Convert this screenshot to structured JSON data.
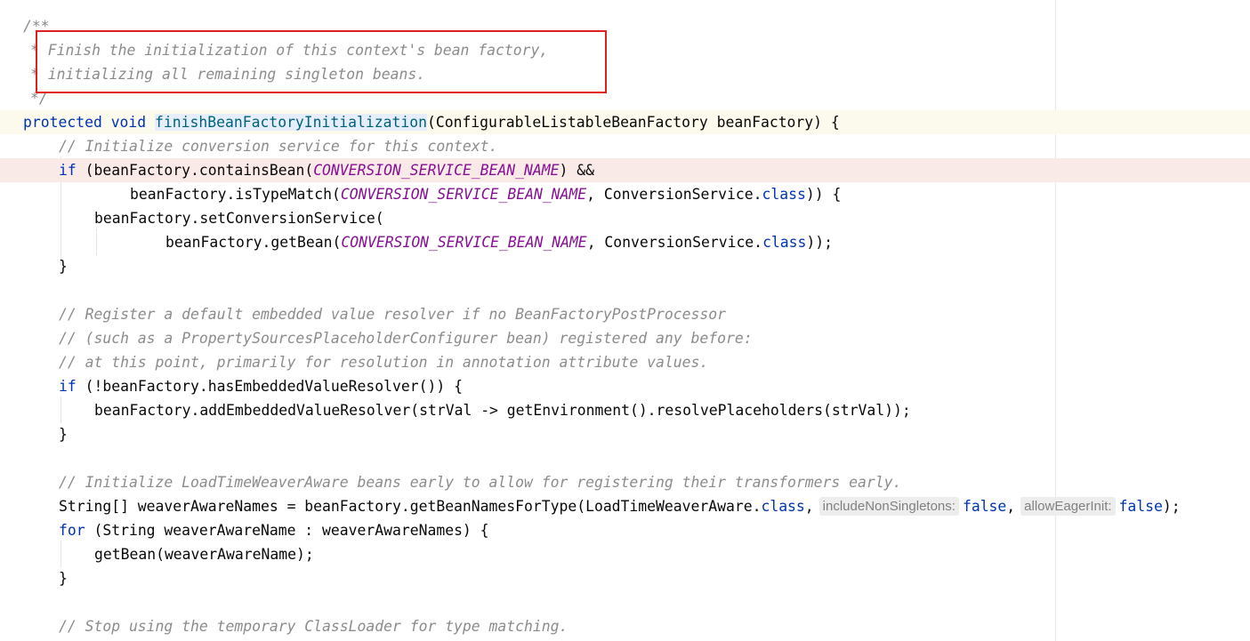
{
  "editor": {
    "lines": [
      {
        "indent": 26,
        "row": 0,
        "tokens": [
          {
            "t": "comment",
            "v": "/**"
          }
        ]
      },
      {
        "indent": 34,
        "row": 1,
        "tokens": [
          {
            "t": "comment",
            "v": "* Finish the initialization of this context's bean factory,"
          }
        ]
      },
      {
        "indent": 34,
        "row": 2,
        "tokens": [
          {
            "t": "comment",
            "v": "* initializing all remaining singleton beans."
          }
        ]
      },
      {
        "indent": 34,
        "row": 3,
        "tokens": [
          {
            "t": "comment",
            "v": "*/"
          }
        ]
      },
      {
        "indent": 26,
        "row": 4,
        "style": "caret-row",
        "tokens": [
          {
            "t": "kw",
            "v": "protected"
          },
          {
            "t": "plain",
            "v": " "
          },
          {
            "t": "kw",
            "v": "void"
          },
          {
            "t": "plain",
            "v": " "
          },
          {
            "t": "caret",
            "v": ""
          },
          {
            "t": "decl",
            "v": "finishBeanFactoryInitialization"
          },
          {
            "t": "plain",
            "v": "(ConfigurableListableBeanFactory beanFactory) {"
          }
        ]
      },
      {
        "indent": 66,
        "row": 5,
        "tokens": [
          {
            "t": "comment",
            "v": "// Initialize conversion service for this context."
          }
        ]
      },
      {
        "indent": 66,
        "row": 6,
        "style": "bp-row",
        "tokens": [
          {
            "t": "kw",
            "v": "if"
          },
          {
            "t": "plain",
            "v": " (beanFactory.containsBean("
          },
          {
            "t": "const",
            "v": "CONVERSION_SERVICE_BEAN_NAME"
          },
          {
            "t": "plain",
            "v": ") &&"
          }
        ]
      },
      {
        "indent": 146,
        "row": 7,
        "tokens": [
          {
            "t": "plain",
            "v": "beanFactory.isTypeMatch("
          },
          {
            "t": "const",
            "v": "CONVERSION_SERVICE_BEAN_NAME"
          },
          {
            "t": "plain",
            "v": ", ConversionService."
          },
          {
            "t": "kw",
            "v": "class"
          },
          {
            "t": "plain",
            "v": ")) {"
          }
        ]
      },
      {
        "indent": 106,
        "row": 8,
        "tokens": [
          {
            "t": "plain",
            "v": "beanFactory.setConversionService("
          }
        ]
      },
      {
        "indent": 186,
        "row": 9,
        "tokens": [
          {
            "t": "plain",
            "v": "beanFactory.getBean("
          },
          {
            "t": "const",
            "v": "CONVERSION_SERVICE_BEAN_NAME"
          },
          {
            "t": "plain",
            "v": ", ConversionService."
          },
          {
            "t": "kw",
            "v": "class"
          },
          {
            "t": "plain",
            "v": "));"
          }
        ]
      },
      {
        "indent": 66,
        "row": 10,
        "tokens": [
          {
            "t": "plain",
            "v": "}"
          }
        ]
      },
      {
        "indent": 66,
        "row": 12,
        "tokens": [
          {
            "t": "comment",
            "v": "// Register a default embedded value resolver if no BeanFactoryPostProcessor"
          }
        ]
      },
      {
        "indent": 66,
        "row": 13,
        "tokens": [
          {
            "t": "comment",
            "v": "// (such as a PropertySourcesPlaceholderConfigurer bean) registered any before:"
          }
        ]
      },
      {
        "indent": 66,
        "row": 14,
        "tokens": [
          {
            "t": "comment",
            "v": "// at this point, primarily for resolution in annotation attribute values."
          }
        ]
      },
      {
        "indent": 66,
        "row": 15,
        "tokens": [
          {
            "t": "kw",
            "v": "if"
          },
          {
            "t": "plain",
            "v": " (!beanFactory.hasEmbeddedValueResolver()) {"
          }
        ]
      },
      {
        "indent": 106,
        "row": 16,
        "tokens": [
          {
            "t": "plain",
            "v": "beanFactory.addEmbeddedValueResolver(strVal -> getEnvironment().resolvePlaceholders(strVal));"
          }
        ]
      },
      {
        "indent": 66,
        "row": 17,
        "tokens": [
          {
            "t": "plain",
            "v": "}"
          }
        ]
      },
      {
        "indent": 66,
        "row": 19,
        "tokens": [
          {
            "t": "comment",
            "v": "// Initialize LoadTimeWeaverAware beans early to allow for registering their transformers early."
          }
        ]
      },
      {
        "indent": 66,
        "row": 20,
        "tokens": [
          {
            "t": "plain",
            "v": "String[] weaverAwareNames = beanFactory.getBeanNamesForType(LoadTimeWeaverAware."
          },
          {
            "t": "kw",
            "v": "class"
          },
          {
            "t": "plain",
            "v": ","
          },
          {
            "t": "hint",
            "v": "includeNonSingletons:"
          },
          {
            "t": "kw",
            "v": "false"
          },
          {
            "t": "plain",
            "v": ","
          },
          {
            "t": "hint",
            "v": "allowEagerInit:"
          },
          {
            "t": "kw",
            "v": "false"
          },
          {
            "t": "plain",
            "v": ");"
          }
        ]
      },
      {
        "indent": 66,
        "row": 21,
        "tokens": [
          {
            "t": "kw",
            "v": "for"
          },
          {
            "t": "plain",
            "v": " (String weaverAwareName : weaverAwareNames) {"
          }
        ]
      },
      {
        "indent": 106,
        "row": 22,
        "tokens": [
          {
            "t": "plain",
            "v": "getBean(weaverAwareName);"
          }
        ]
      },
      {
        "indent": 66,
        "row": 23,
        "tokens": [
          {
            "t": "plain",
            "v": "}"
          }
        ]
      },
      {
        "indent": 66,
        "row": 25,
        "tokens": [
          {
            "t": "comment",
            "v": "// Stop using the temporary ClassLoader for type matching."
          }
        ]
      }
    ]
  }
}
